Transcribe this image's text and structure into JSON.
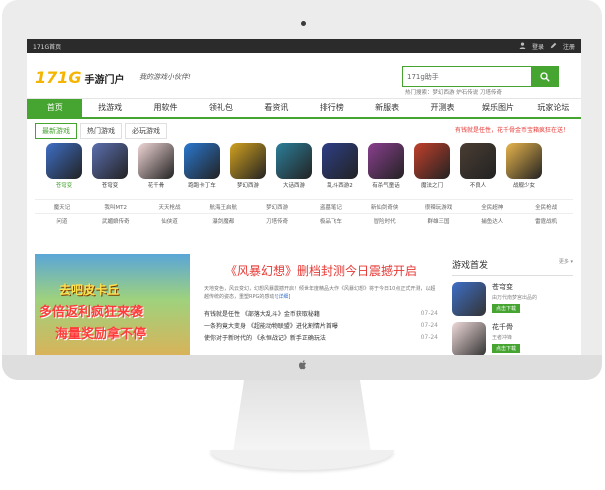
{
  "topbar": {
    "home_label": "171G首页",
    "login_label": "登录",
    "register_label": "注册"
  },
  "header": {
    "logo_number": "171G",
    "logo_text": "手游门户",
    "slogan": "我的游戏小伙伴!",
    "search_value": "171g助手",
    "hot_label": "热门搜索：",
    "hot_terms": "梦幻西游 炉石传说 刀塔传奇"
  },
  "nav": [
    "首页",
    "找游戏",
    "用软件",
    "领礼包",
    "看资讯",
    "排行榜",
    "新服表",
    "开测表",
    "娱乐图片",
    "玩家论坛"
  ],
  "game_tabs": [
    "最新游戏",
    "热门游戏",
    "必玩游戏"
  ],
  "promo": "有钱就是任性，花千骨金币宝箱疯狂在送！",
  "games": [
    {
      "name": "苍穹变",
      "color": "#3e6fc7",
      "selected": true
    },
    {
      "name": "苍穹变",
      "color": "#5b6fb0",
      "selected": false
    },
    {
      "name": "花千骨",
      "color": "#f1d6d6",
      "selected": false
    },
    {
      "name": "跑跑卡丁车",
      "color": "#2a78d0",
      "selected": false
    },
    {
      "name": "梦幻西游",
      "color": "#d2a21f",
      "selected": false
    },
    {
      "name": "大话西游",
      "color": "#2c7f9a",
      "selected": false
    },
    {
      "name": "乱斗西游2",
      "color": "#2d3f86",
      "selected": false
    },
    {
      "name": "有杀气童话",
      "color": "#8a3f8f",
      "selected": false
    },
    {
      "name": "魔法之门",
      "color": "#c2402b",
      "selected": false
    },
    {
      "name": "不良人",
      "color": "#4a3d33",
      "selected": false
    },
    {
      "name": "战舰少女",
      "color": "#e8b54c",
      "selected": false
    }
  ],
  "name_rows": [
    [
      "魔天记",
      "我叫MT2",
      "天天枪战",
      "航海王启航",
      "梦幻西游",
      "盗墓笔记",
      "新仙剑奇侠",
      "很辣玩游戏",
      "全民超神",
      "全民枪战"
    ],
    [
      "问道",
      "武媚娘传奇",
      "仙侠道",
      "瀑剑魔都",
      "刀塔传奇",
      "极品飞车",
      "冒险时代",
      "群雄三国",
      "捕鱼达人",
      "雷霆战机"
    ]
  ],
  "banner": {
    "line1": "去吧皮卡丘",
    "line2": "多倍返利疯狂来袭",
    "line3": "海量奖励拿不停"
  },
  "news": {
    "headline": "《风暴幻想》删档封测今日震撼开启",
    "summary": "天地变色，风云变幻，幻想风暴震撼开启！倾世年度精品大作《风暴幻想》将于今日10点正式开测，以超越传统的姿态，重塑RPG的感动!",
    "summary_link": "[详细]",
    "items": [
      {
        "title": "有钱就是任性 《部落大乱斗》金币获取秘籍",
        "date": "07-24"
      },
      {
        "title": "一条狗竟大变身 《超能动物联盟》进化割情片首曝",
        "date": "07-24"
      },
      {
        "title": "使你对于新时代的 《永恒战记》新手正确玩法",
        "date": "07-24"
      }
    ]
  },
  "side": {
    "title": "游戏首发",
    "more": "更多 ▾",
    "games": [
      {
        "name": "苍穹变",
        "desc": "由万代南梦宫出品的",
        "download": "点击下载",
        "color": "#3e6fc7"
      },
      {
        "name": "花千骨",
        "desc": "王者冲锋",
        "download": "点击下载",
        "color": "#f0dada"
      }
    ]
  },
  "colors": {
    "accent": "#46a530",
    "logo": "#f4b400",
    "headline": "#e53935",
    "topbar": "#2b2b2b"
  }
}
